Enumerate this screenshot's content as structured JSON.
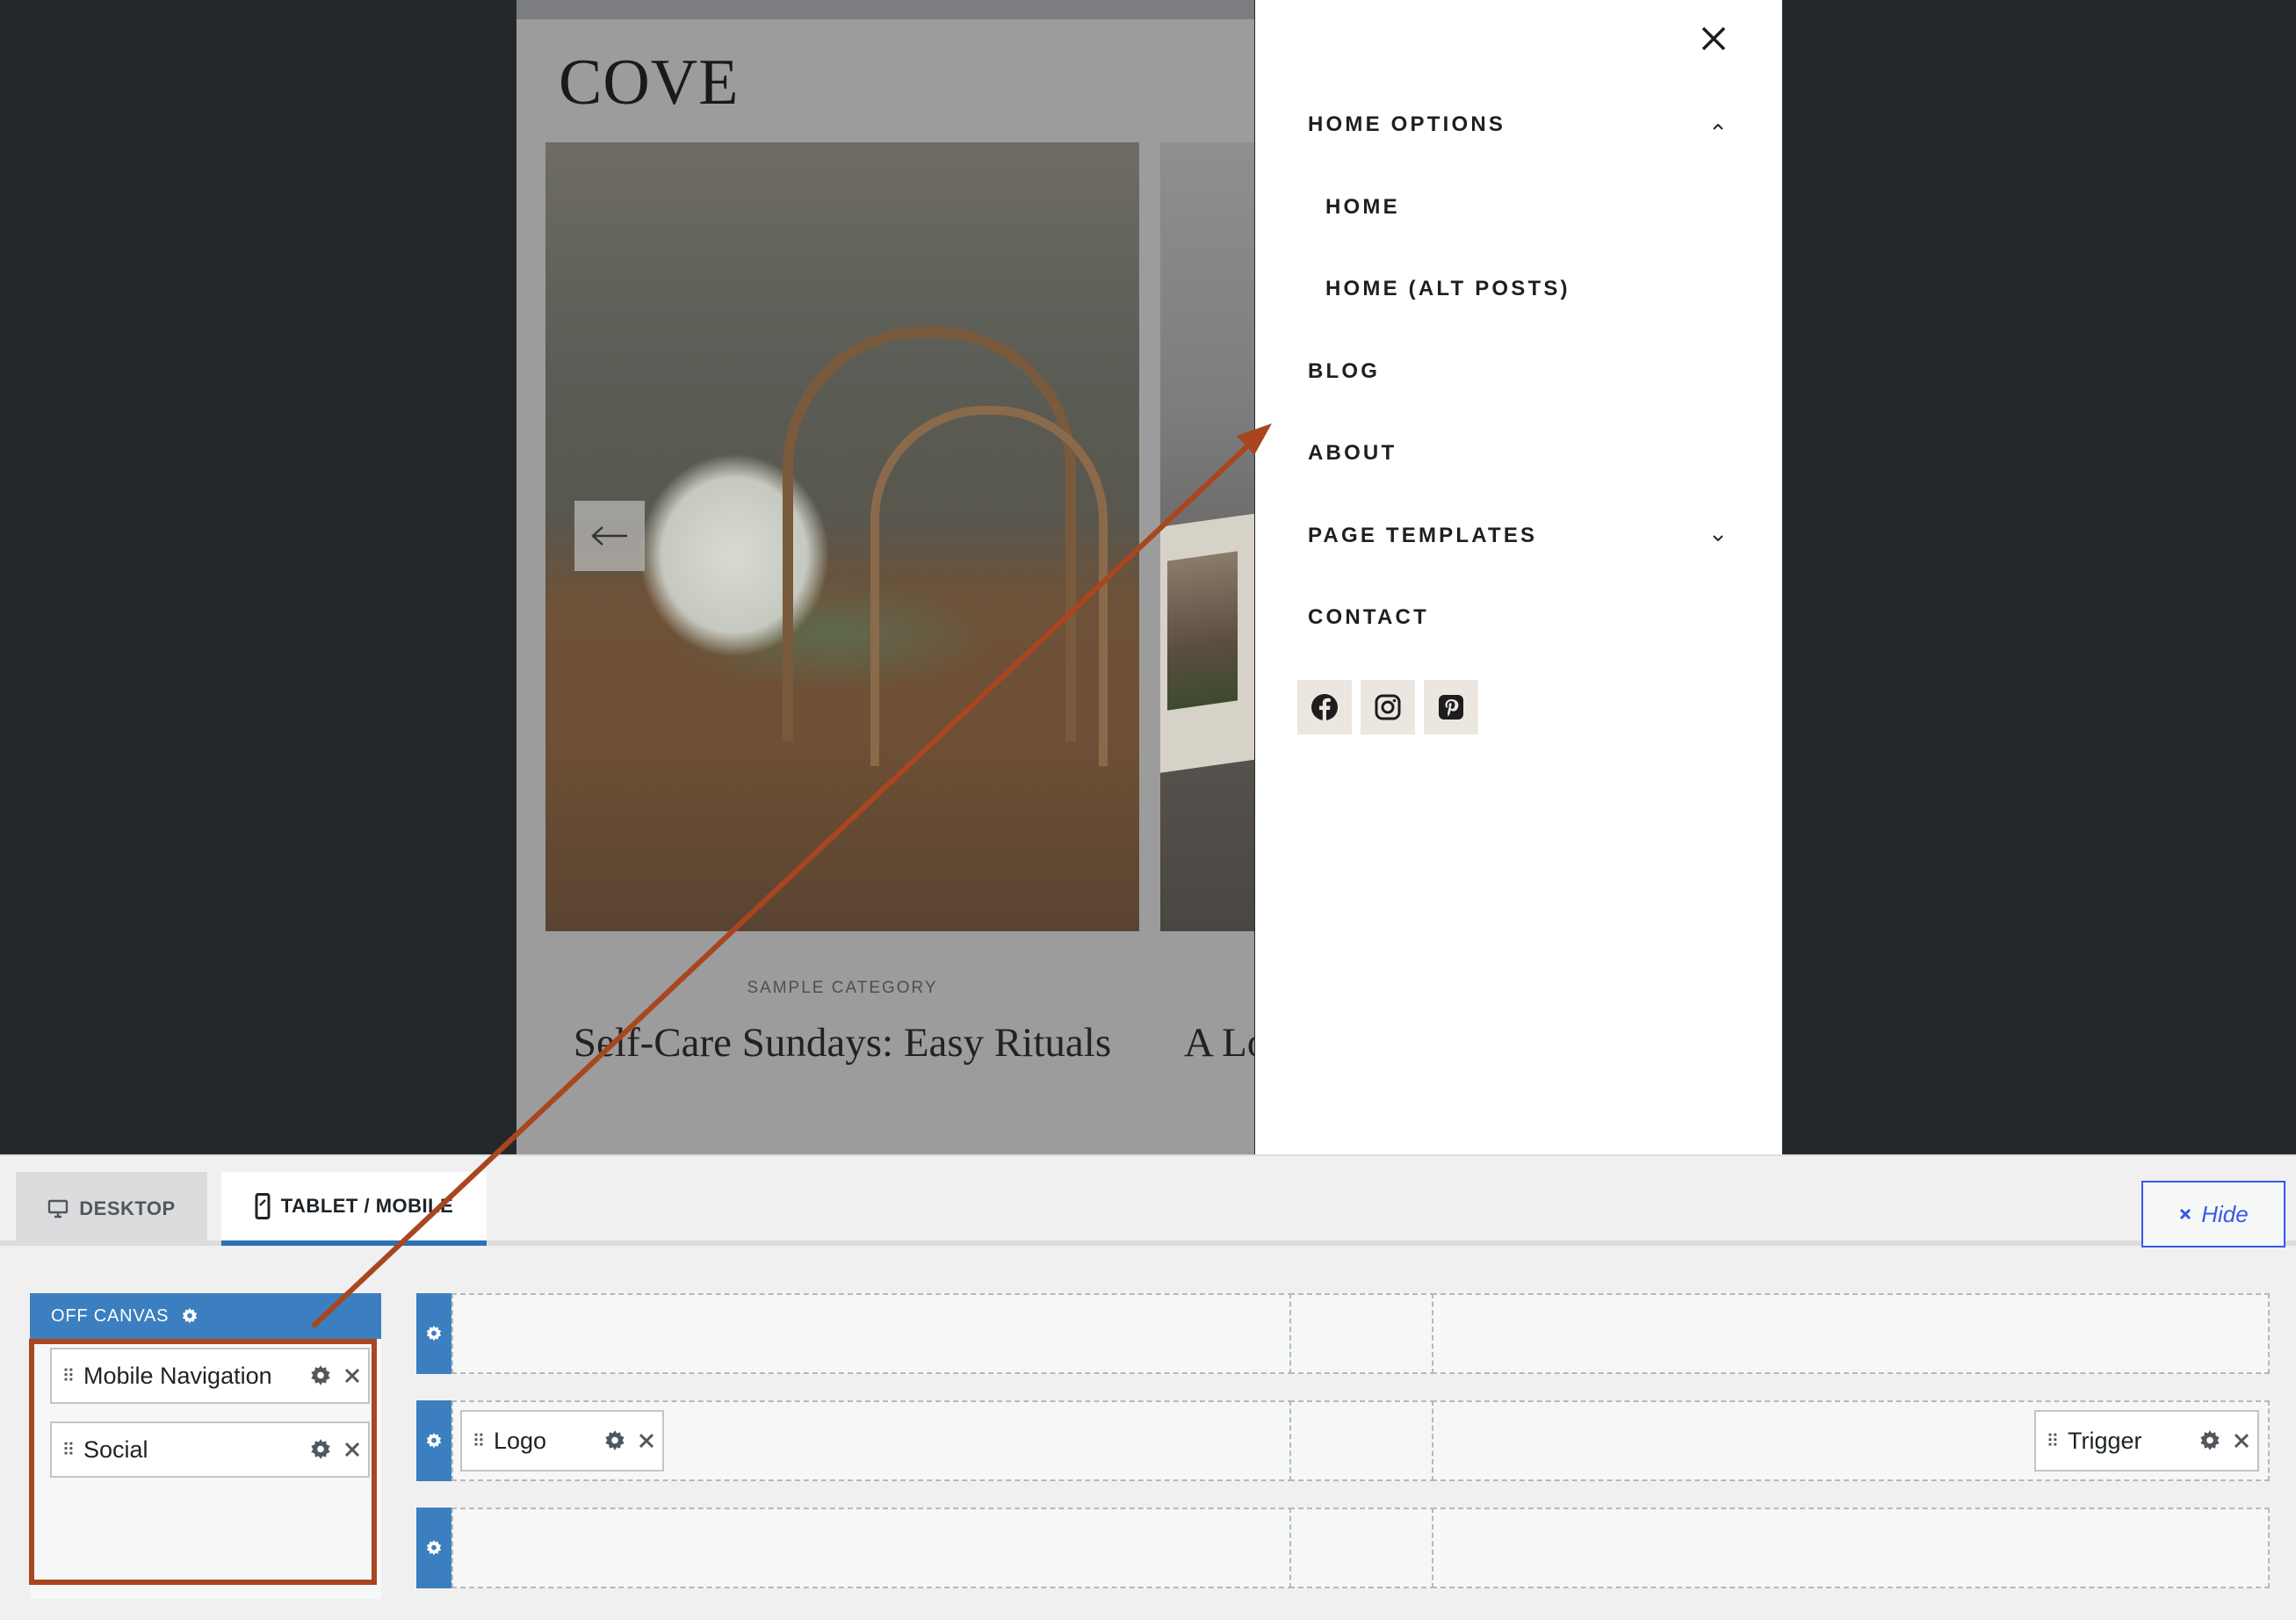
{
  "preview": {
    "site_logo": "COVE",
    "post": {
      "category": "SAMPLE CATEGORY",
      "title": "Self-Care Sundays: Easy Rituals",
      "next_title_partial": "A Lo"
    }
  },
  "offcanvas_menu": {
    "items": [
      {
        "label": "HOME OPTIONS",
        "expanded": true
      },
      {
        "label": "HOME",
        "sub": true
      },
      {
        "label": "HOME (ALT POSTS)",
        "sub": true
      },
      {
        "label": "BLOG"
      },
      {
        "label": "ABOUT"
      },
      {
        "label": "PAGE TEMPLATES",
        "expanded": false
      },
      {
        "label": "CONTACT"
      }
    ],
    "social": [
      "facebook-icon",
      "instagram-icon",
      "pinterest-icon"
    ]
  },
  "builder": {
    "tabs": {
      "desktop": "DESKTOP",
      "mobile": "TABLET / MOBILE"
    },
    "active_tab": "TABLET / MOBILE",
    "hide_label": "Hide",
    "offcanvas": {
      "header": "OFF CANVAS",
      "widgets": [
        "Mobile Navigation",
        "Social"
      ]
    },
    "rows": {
      "middle": {
        "left_widget": "Logo",
        "right_widget": "Trigger"
      }
    }
  },
  "colors": {
    "accent_blue": "#3c7fc0",
    "annotation": "#a9461f",
    "hide_blue": "#3858e9"
  }
}
